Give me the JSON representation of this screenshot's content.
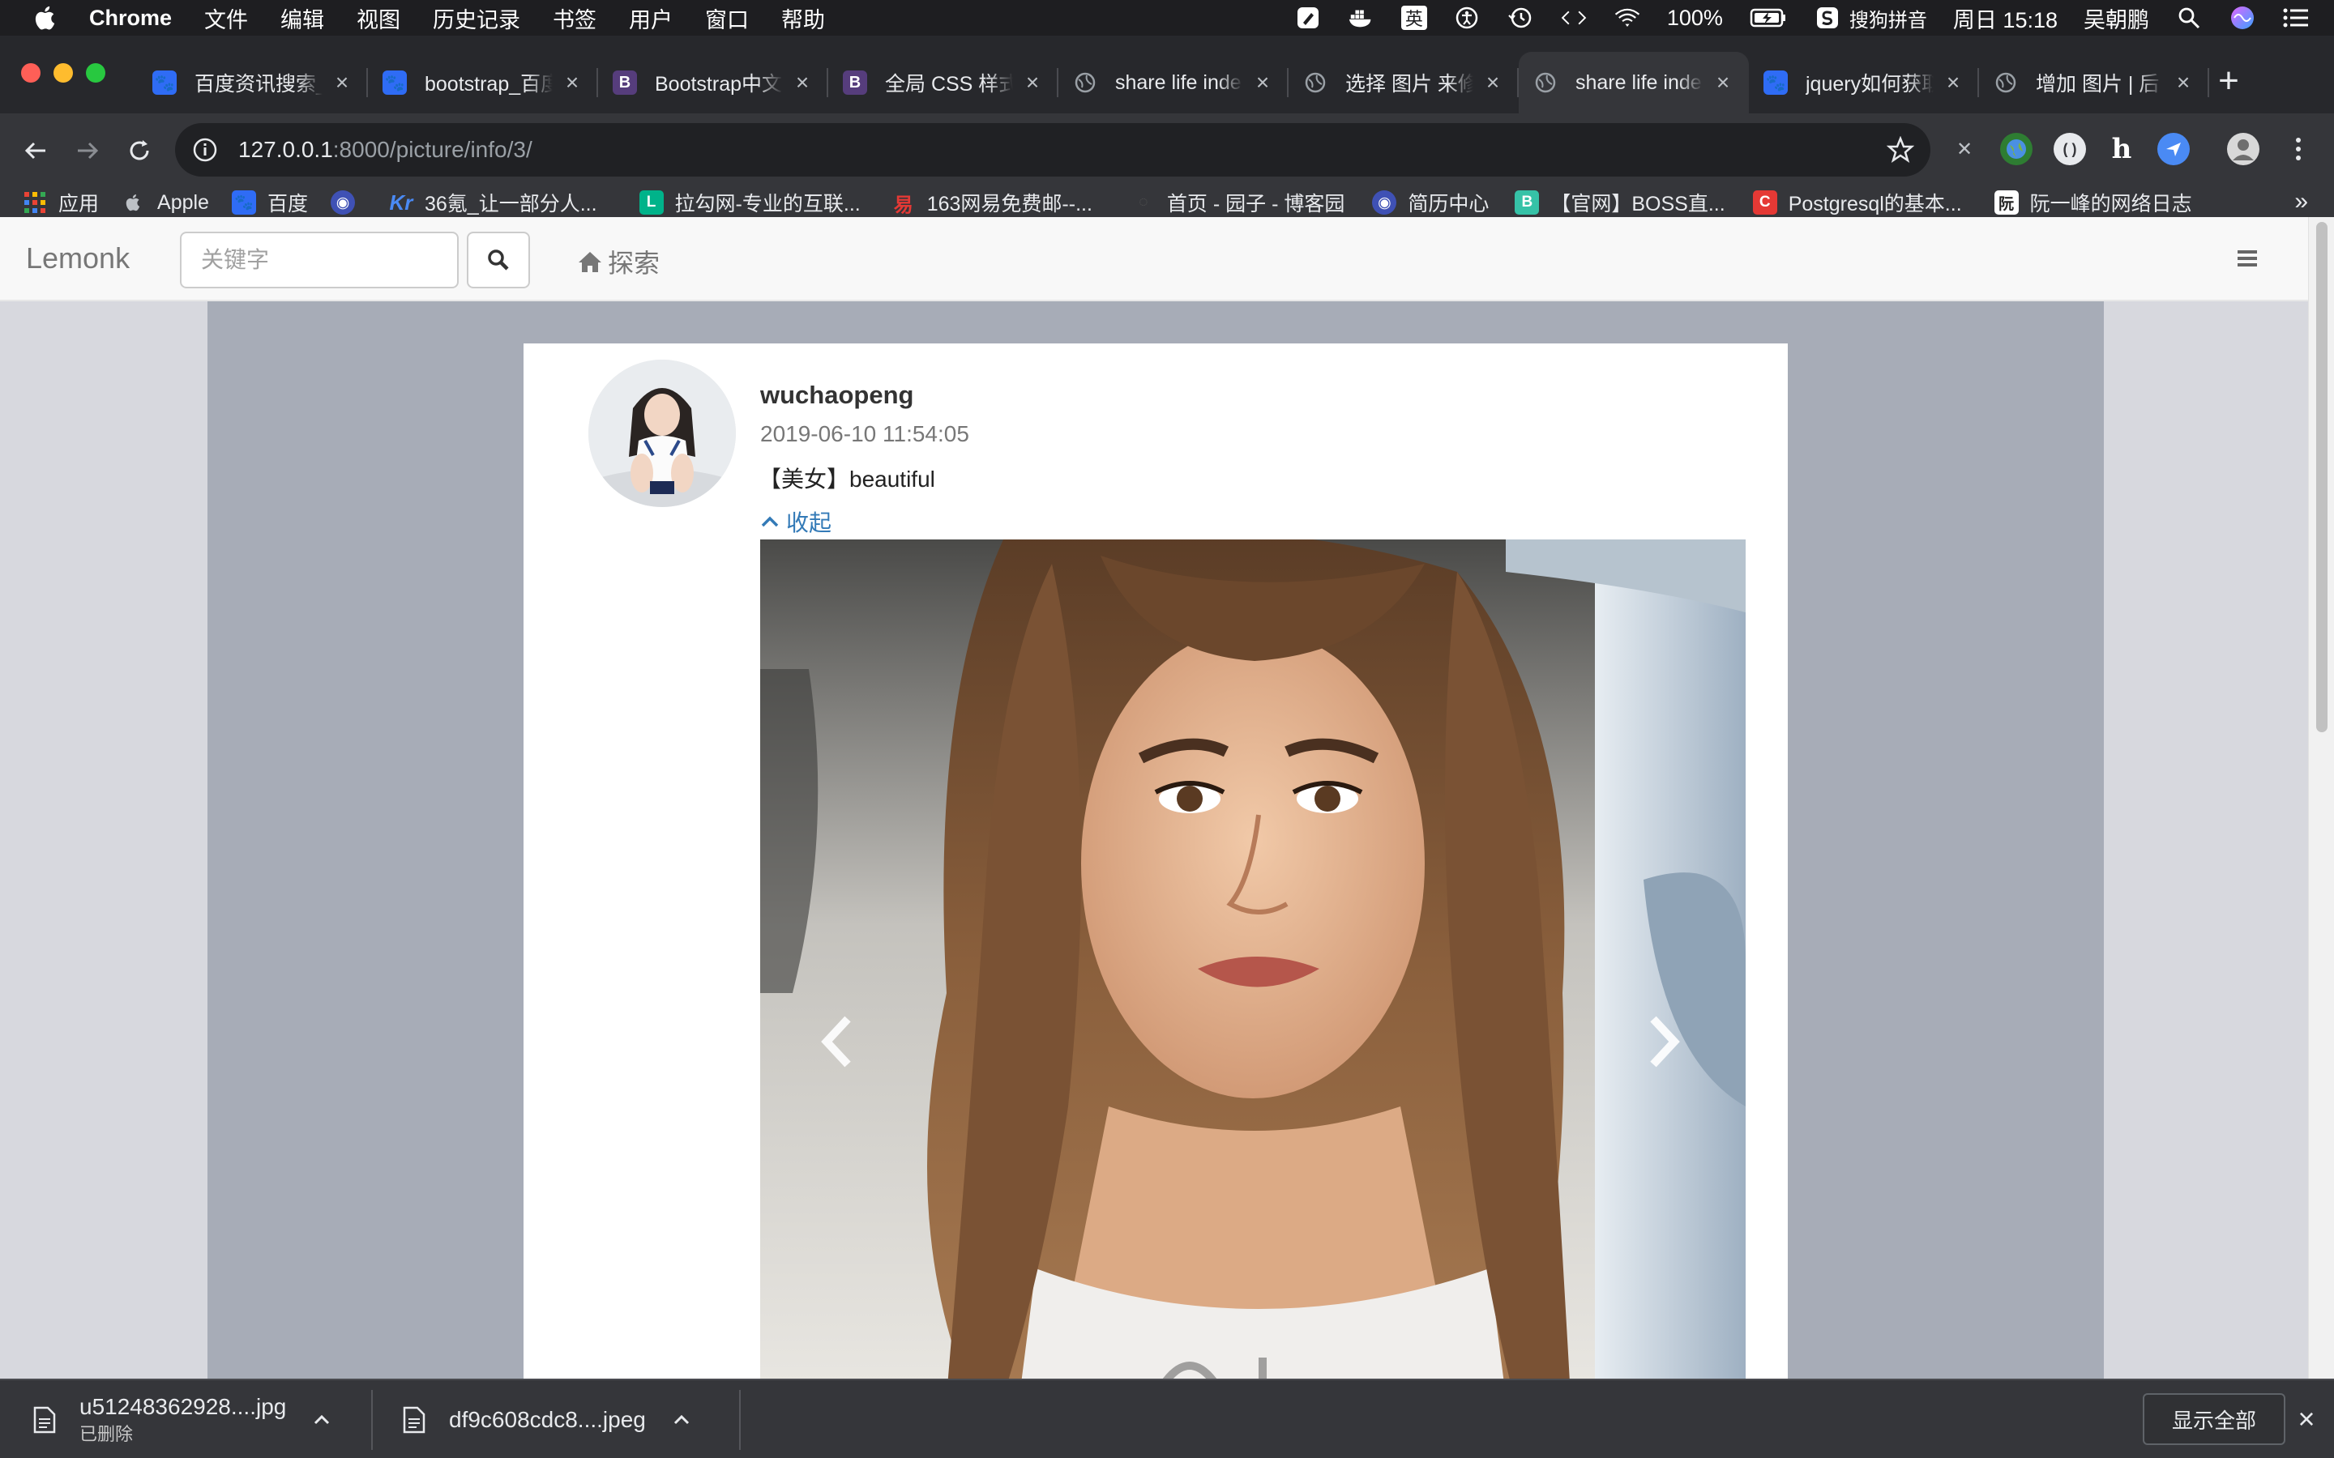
{
  "menubar": {
    "app": "Chrome",
    "items": [
      "文件",
      "编辑",
      "视图",
      "历史记录",
      "书签",
      "用户",
      "窗口",
      "帮助"
    ],
    "input_method_label": "英",
    "battery": "100%",
    "ime_name": "搜狗拼音",
    "clock": "周日 15:18",
    "user": "吴朝鹏"
  },
  "tabs": [
    {
      "title": "百度资讯搜索_",
      "favicon": "baidu-paw-icon"
    },
    {
      "title": "bootstrap_百度",
      "favicon": "baidu-paw-icon"
    },
    {
      "title": "Bootstrap中文",
      "favicon": "bootstrap-b-icon"
    },
    {
      "title": "全局 CSS 样式",
      "favicon": "bootstrap-b-icon"
    },
    {
      "title": "share life inde",
      "favicon": "globe-icon"
    },
    {
      "title": "选择 图片 来修",
      "favicon": "globe-icon"
    },
    {
      "title": "share life inde",
      "favicon": "globe-icon",
      "active": true
    },
    {
      "title": "jquery如何获取",
      "favicon": "baidu-paw-icon"
    },
    {
      "title": "增加 图片 | 后",
      "favicon": "globe-icon"
    }
  ],
  "address": {
    "host": "127.0.0.1",
    "path": ":8000/picture/info/3/"
  },
  "bookmarks": [
    {
      "label": "应用",
      "icon": "apps-grid-icon"
    },
    {
      "label": "Apple",
      "icon": "apple-icon"
    },
    {
      "label": "百度",
      "icon": "baidu-paw-icon"
    },
    {
      "label": "",
      "icon": "globe-blue-icon"
    },
    {
      "label": "36氪_让一部分人...",
      "icon": "kr-icon"
    },
    {
      "label": "拉勾网-专业的互联...",
      "icon": "lagou-l-icon"
    },
    {
      "label": "163网易免费邮--...",
      "icon": "netease-icon"
    },
    {
      "label": "首页 - 园子 - 博客园",
      "icon": "cnblogs-icon"
    },
    {
      "label": "简历中心",
      "icon": "globe-blue-icon"
    },
    {
      "label": "【官网】BOSS直...",
      "icon": "boss-b-icon"
    },
    {
      "label": "Postgresql的基本...",
      "icon": "csdn-c-icon"
    },
    {
      "label": "阮一峰的网络日志",
      "icon": "ruanyifeng-icon"
    }
  ],
  "bookmarks_more": "»",
  "site": {
    "brand": "Lemonk",
    "search_placeholder": "关键字",
    "explore_label": "探索"
  },
  "post": {
    "username": "wuchaopeng",
    "timestamp": "2019-06-10 11:54:05",
    "caption": "【美女】beautiful",
    "collapse_label": "收起"
  },
  "downloads": [
    {
      "filename": "u51248362928....jpg",
      "status": "已删除"
    },
    {
      "filename": "df9c608cdc8....jpeg",
      "status": ""
    }
  ],
  "show_all_label": "显示全部",
  "colors": {
    "link": "#337ab7",
    "chrome_dark": "#35363a",
    "page_gray": "#a7acb7"
  }
}
